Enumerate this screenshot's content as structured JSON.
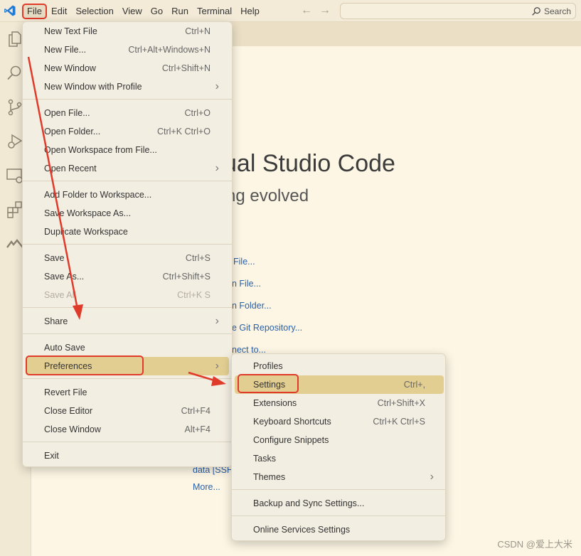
{
  "menubar": [
    "File",
    "Edit",
    "Selection",
    "View",
    "Go",
    "Run",
    "Terminal",
    "Help"
  ],
  "search": {
    "label": "Search"
  },
  "welcome": {
    "title": "ual Studio Code",
    "subtitle": "ng evolved",
    "links": [
      {
        "text": "File..."
      },
      {
        "text": "n File..."
      },
      {
        "text": "n Folder..."
      },
      {
        "text": "e Git Repository..."
      },
      {
        "text": "nect to..."
      },
      {
        "text": "data [SSH"
      },
      {
        "text": "More..."
      }
    ]
  },
  "file_menu": {
    "items": [
      {
        "label": "New Text File",
        "shortcut": "Ctrl+N"
      },
      {
        "label": "New File...",
        "shortcut": "Ctrl+Alt+Windows+N"
      },
      {
        "label": "New Window",
        "shortcut": "Ctrl+Shift+N"
      },
      {
        "label": "New Window with Profile",
        "shortcut": ""
      },
      {
        "label": "Open File...",
        "shortcut": "Ctrl+O"
      },
      {
        "label": "Open Folder...",
        "shortcut": "Ctrl+K Ctrl+O"
      },
      {
        "label": "Open Workspace from File...",
        "shortcut": ""
      },
      {
        "label": "Open Recent",
        "shortcut": ""
      },
      {
        "label": "Add Folder to Workspace...",
        "shortcut": ""
      },
      {
        "label": "Save Workspace As...",
        "shortcut": ""
      },
      {
        "label": "Duplicate Workspace",
        "shortcut": ""
      },
      {
        "label": "Save",
        "shortcut": "Ctrl+S"
      },
      {
        "label": "Save As...",
        "shortcut": "Ctrl+Shift+S"
      },
      {
        "label": "Save All",
        "shortcut": "Ctrl+K S"
      },
      {
        "label": "Share",
        "shortcut": ""
      },
      {
        "label": "Auto Save",
        "shortcut": ""
      },
      {
        "label": "Preferences",
        "shortcut": ""
      },
      {
        "label": "Revert File",
        "shortcut": ""
      },
      {
        "label": "Close Editor",
        "shortcut": "Ctrl+F4"
      },
      {
        "label": "Close Window",
        "shortcut": "Alt+F4"
      },
      {
        "label": "Exit",
        "shortcut": ""
      }
    ]
  },
  "preferences_menu": {
    "items": [
      {
        "label": "Profiles",
        "shortcut": ""
      },
      {
        "label": "Settings",
        "shortcut": "Ctrl+,"
      },
      {
        "label": "Extensions",
        "shortcut": "Ctrl+Shift+X"
      },
      {
        "label": "Keyboard Shortcuts",
        "shortcut": "Ctrl+K Ctrl+S"
      },
      {
        "label": "Configure Snippets",
        "shortcut": ""
      },
      {
        "label": "Tasks",
        "shortcut": ""
      },
      {
        "label": "Themes",
        "shortcut": ""
      },
      {
        "label": "Backup and Sync Settings...",
        "shortcut": ""
      },
      {
        "label": "Online Services Settings",
        "shortcut": ""
      }
    ]
  },
  "watermark": "CSDN @爱上大米",
  "colors": {
    "highlight": "#e3ce92",
    "annotation": "#e03a2a",
    "link": "#2a61a8"
  }
}
